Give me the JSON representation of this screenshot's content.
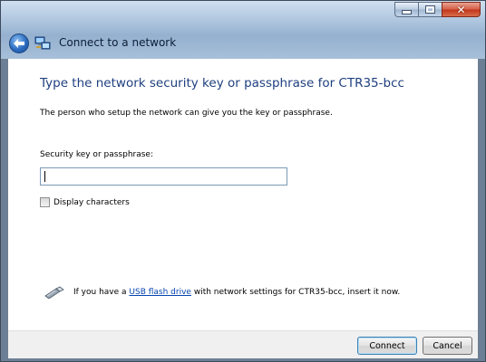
{
  "window": {
    "title": "Connect to a network"
  },
  "main": {
    "heading": "Type the network security key or passphrase for CTR35-bcc",
    "description": "The person who setup the network can give you the key or passphrase.",
    "key_label": "Security key or passphrase:",
    "key_value": "",
    "display_characters_label": "Display characters",
    "display_characters_checked": false,
    "usb_prefix": "If you have a ",
    "usb_link": "USB flash drive",
    "usb_suffix": " with network settings for CTR35-bcc, insert it now."
  },
  "buttons": {
    "connect": "Connect",
    "cancel": "Cancel"
  },
  "icons": {
    "back": "back-arrow-icon",
    "network": "network-icon",
    "usb": "usb-drive-icon"
  },
  "colors": {
    "heading": "#1f3f7f",
    "link": "#0645ad"
  }
}
